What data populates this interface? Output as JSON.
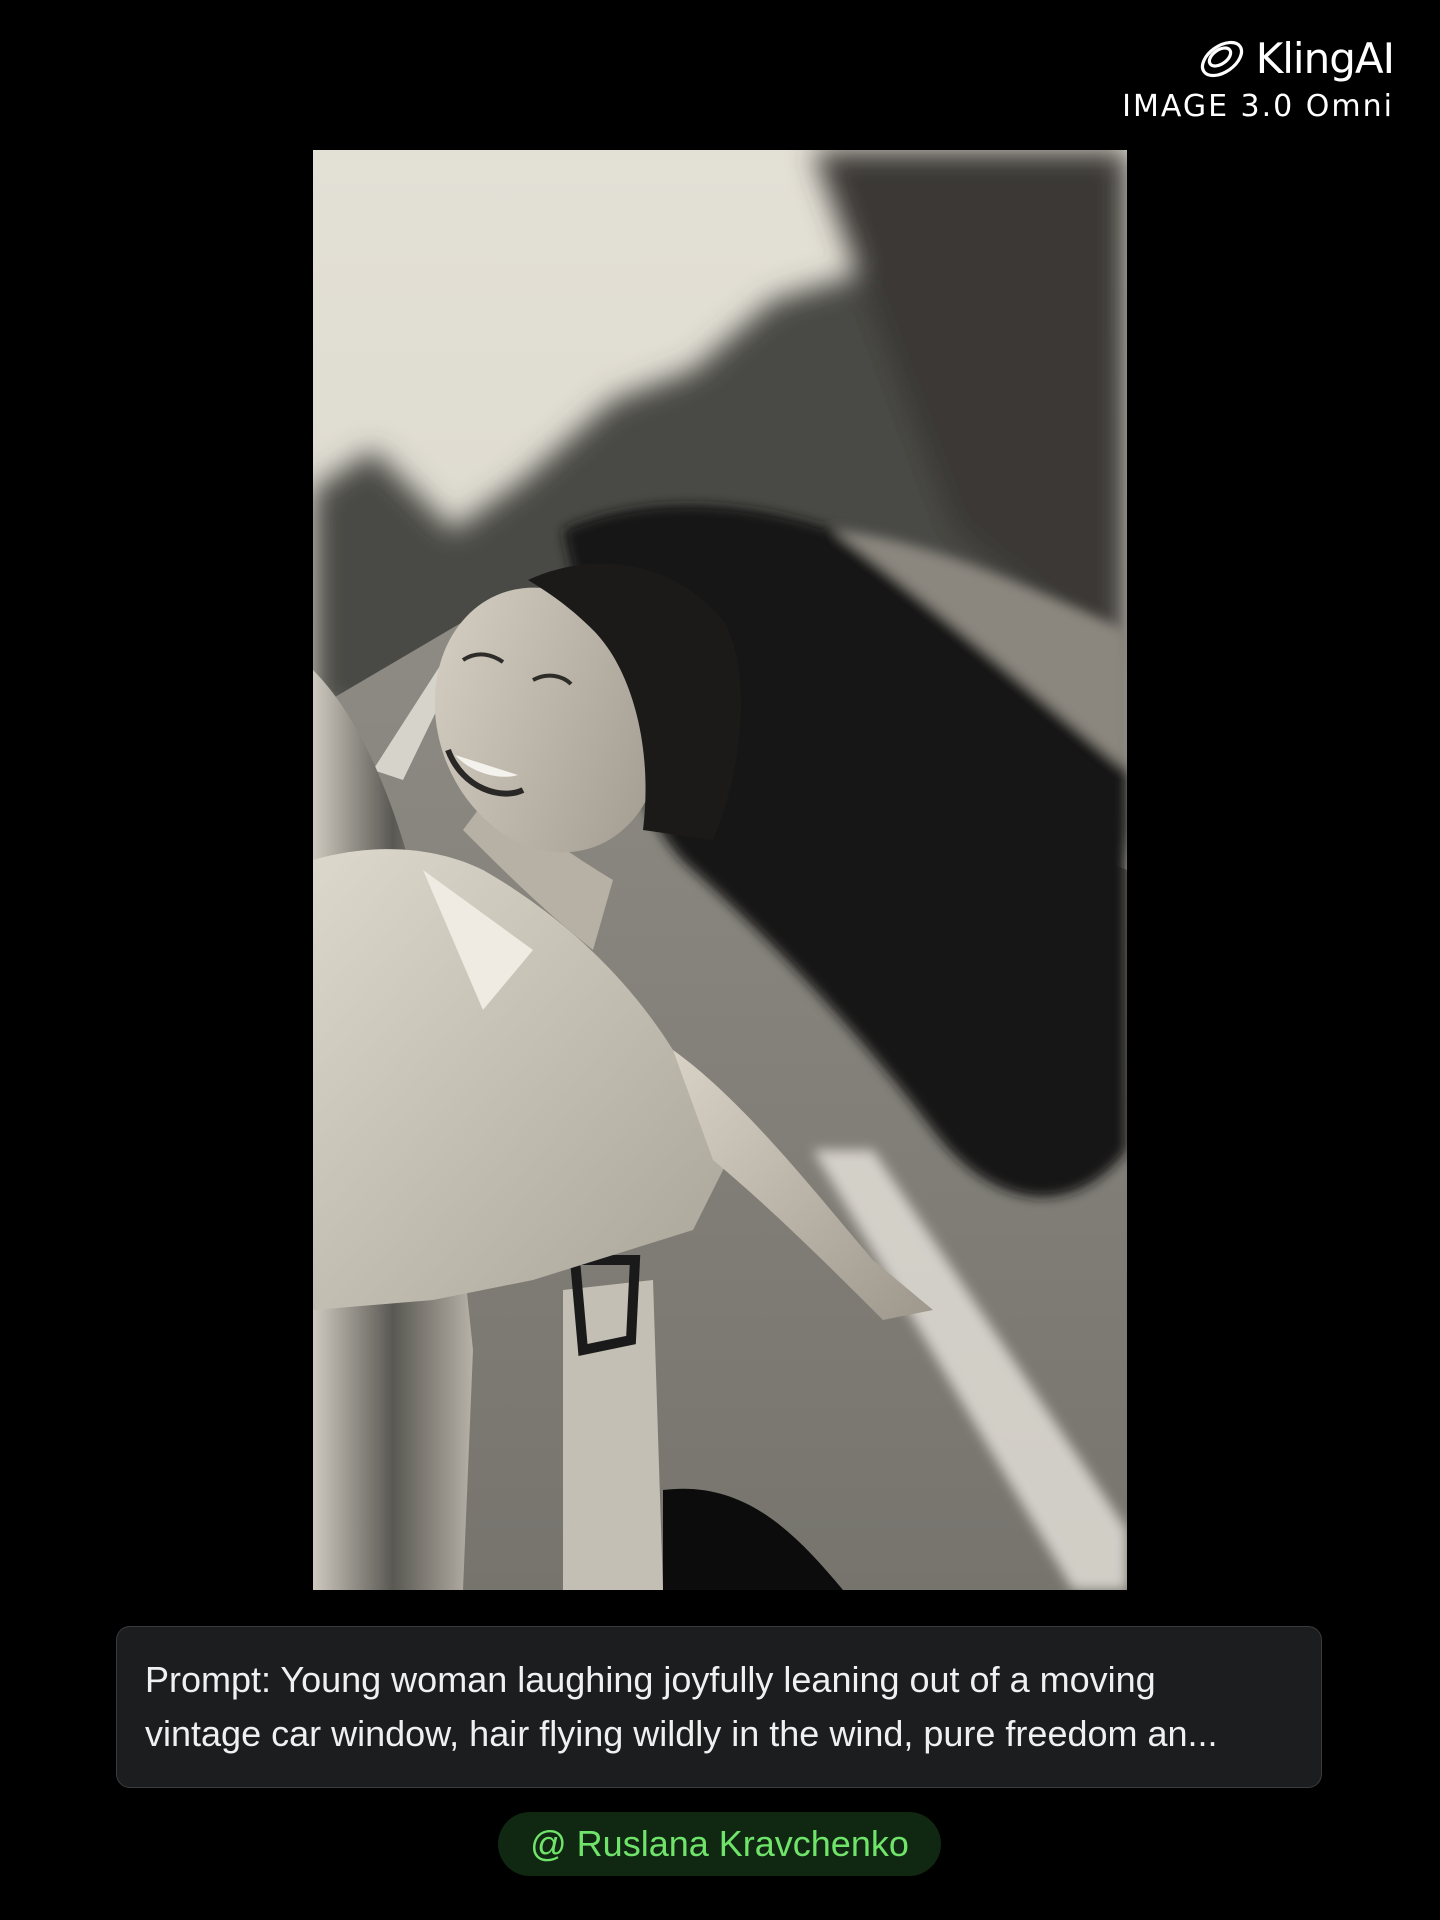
{
  "brand": {
    "name": "KlingAI",
    "version": "IMAGE 3.0 Omni",
    "logo_icon": "klingai-logo-icon"
  },
  "image": {
    "description_icon": "photo-woman-in-car-window"
  },
  "prompt": {
    "line1": "Prompt: Young woman laughing joyfully leaning out of a moving",
    "line2": "vintage car window, hair flying wildly in the wind, pure freedom an..."
  },
  "credit": {
    "label": "@ Ruslana Kravchenko"
  },
  "colors": {
    "background": "#000000",
    "prompt_bg": "#1c1d1f",
    "credit_bg": "#102712",
    "credit_text": "#6fe36a"
  }
}
